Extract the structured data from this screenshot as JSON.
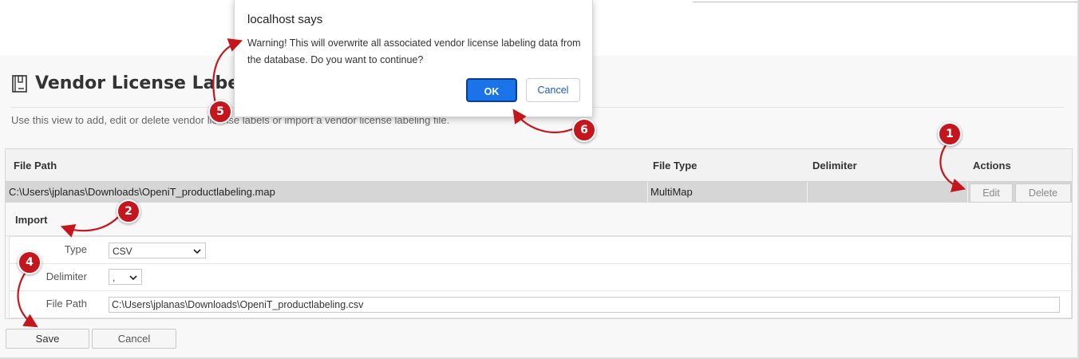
{
  "dialog": {
    "title": "localhost says",
    "message": "Warning! This will overwrite all associated vendor license labeling data from the database. Do you want to continue?",
    "ok_label": "OK",
    "cancel_label": "Cancel"
  },
  "page": {
    "title": "Vendor License Labelin",
    "description": "Use this view to add, edit or delete vendor license labels or import a vendor license labeling file."
  },
  "table": {
    "headers": [
      "File Path",
      "File Type",
      "Delimiter",
      "Actions"
    ],
    "row": {
      "file_path": "C:\\Users\\jplanas\\Downloads\\OpeniT_productlabeling.map",
      "file_type": "MultiMap",
      "delimiter": "",
      "edit_label": "Edit",
      "delete_label": "Delete"
    }
  },
  "import": {
    "title": "Import",
    "type_label": "Type",
    "type_value": "CSV",
    "delimiter_label": "Delimiter",
    "delimiter_value": ",",
    "file_path_label": "File Path",
    "file_path_value": "C:\\Users\\jplanas\\Downloads\\OpeniT_productlabeling.csv"
  },
  "actions": {
    "save_label": "Save",
    "cancel_label": "Cancel"
  },
  "annotations": [
    "1",
    "2",
    "4",
    "5",
    "6"
  ],
  "colors": {
    "annotation": "#c4161c",
    "ok_button": "#1a73e8"
  }
}
